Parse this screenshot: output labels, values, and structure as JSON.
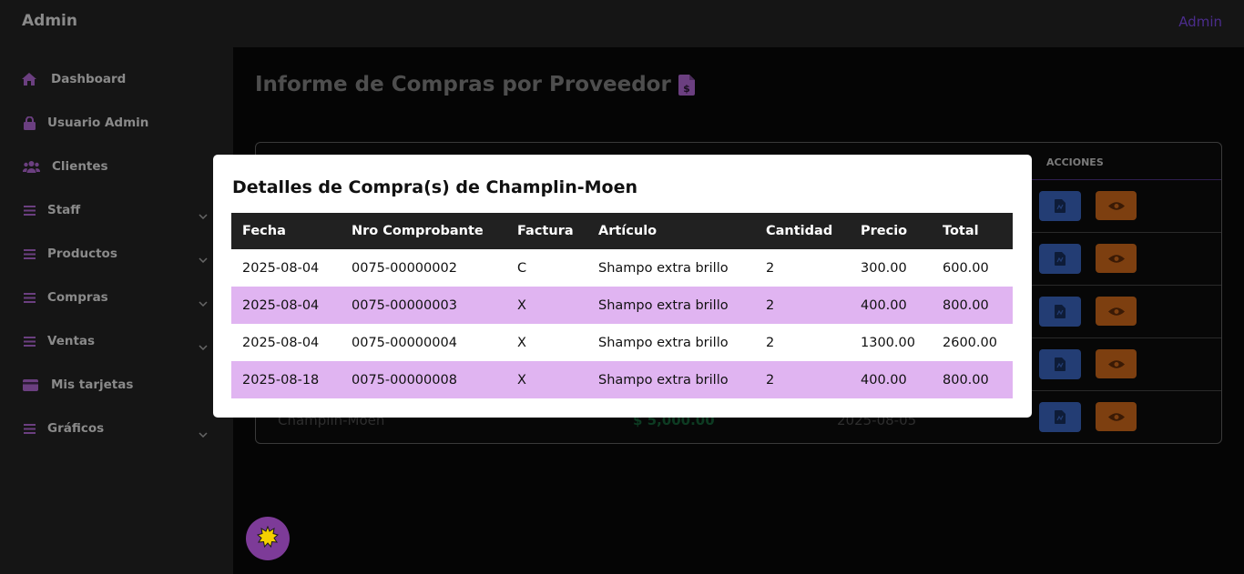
{
  "app": {
    "brand": "Admin",
    "user_link": "Admin"
  },
  "sidebar": {
    "items": [
      {
        "label": "Dashboard",
        "icon": "home-icon",
        "has_submenu": false
      },
      {
        "label": "Usuario Admin",
        "icon": "lock-icon",
        "has_submenu": false
      },
      {
        "label": "Clientes",
        "icon": "users-icon",
        "has_submenu": false
      },
      {
        "label": "Staff",
        "icon": "menu-icon",
        "has_submenu": true
      },
      {
        "label": "Productos",
        "icon": "menu-icon",
        "has_submenu": true
      },
      {
        "label": "Compras",
        "icon": "menu-icon",
        "has_submenu": true
      },
      {
        "label": "Ventas",
        "icon": "menu-icon",
        "has_submenu": true
      },
      {
        "label": "Mis tarjetas",
        "icon": "credit-card-icon",
        "has_submenu": false
      },
      {
        "label": "Gráficos",
        "icon": "menu-icon",
        "has_submenu": true
      }
    ]
  },
  "main": {
    "title": "Informe de Compras por Proveedor",
    "title_icon": "invoice-dollar-icon",
    "table": {
      "actions_header": "ACCIONES",
      "row_count": 5,
      "last_row_partial": {
        "supplier": "Champlin-Moen",
        "amount": "$ 5,000.00",
        "date": "2025-08-05"
      }
    }
  },
  "modal": {
    "title": "Detalles de Compra(s) de Champlin-Moen",
    "headers": [
      "Fecha",
      "Nro Comprobante",
      "Factura",
      "Artículo",
      "Cantidad",
      "Precio",
      "Total"
    ],
    "rows": [
      [
        "2025-08-04",
        "0075-00000002",
        "C",
        "Shampo extra brillo",
        "2",
        "300.00",
        "600.00"
      ],
      [
        "2025-08-04",
        "0075-00000003",
        "X",
        "Shampo extra brillo",
        "2",
        "400.00",
        "800.00"
      ],
      [
        "2025-08-04",
        "0075-00000004",
        "X",
        "Shampo extra brillo",
        "2",
        "1300.00",
        "2600.00"
      ],
      [
        "2025-08-18",
        "0075-00000008",
        "X",
        "Shampo extra brillo",
        "2",
        "400.00",
        "800.00"
      ]
    ]
  },
  "colors": {
    "accent_purple": "#7d3b98",
    "row_highlight": "#e0b4f1",
    "pdf_button": "#233d74",
    "view_button": "#7d3f10"
  }
}
